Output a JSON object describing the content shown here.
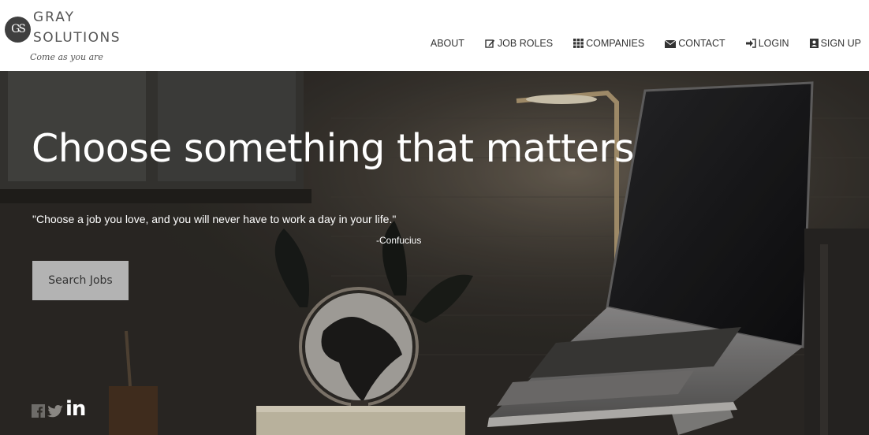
{
  "brand": {
    "mark": "GS",
    "line1": "GRAY",
    "line2": "SOLUTIONS",
    "tagline": "Come as you are"
  },
  "nav": {
    "about": "ABOUT",
    "job_roles": "JOB ROLES",
    "companies": "COMPANIES",
    "contact": "CONTACT",
    "login": "LOGIN",
    "sign_up": "SIGN UP"
  },
  "hero": {
    "title": "Choose something that matters",
    "quote": "\"Choose a job you love, and you will never have to work a day in your life.\"",
    "quote_author": "-Confucius",
    "search_button": "Search Jobs"
  },
  "social": {
    "icons": [
      "facebook-icon",
      "twitter-icon",
      "linkedin-icon"
    ],
    "linkedin_text": "in"
  },
  "colors": {
    "header_bg": "#ffffff",
    "nav_text": "#333333",
    "hero_text": "#ffffff",
    "button_bg": "#b3b3b3"
  }
}
